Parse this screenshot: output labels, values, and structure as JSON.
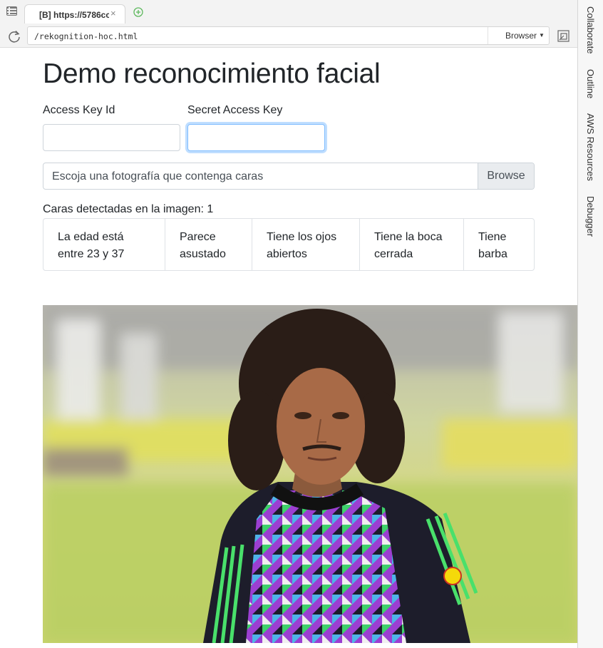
{
  "browser": {
    "tab_title": "[B] https://5786cc",
    "tab_close": "×",
    "url": "/rekognition-hoc.html",
    "browser_select": "Browser"
  },
  "side_panel": {
    "tabs": [
      "Collaborate",
      "Outline",
      "AWS Resources",
      "Debugger"
    ]
  },
  "page": {
    "title": "Demo reconocimiento facial",
    "access_key_label": "Access Key Id",
    "secret_key_label": "Secret Access Key",
    "access_key_value": "",
    "secret_key_value": "",
    "file_placeholder": "Escoja una fotografía que contenga caras",
    "browse_label": "Browse",
    "faces_label": "Caras detectadas en la imagen:",
    "faces_count": "1",
    "attributes": [
      [
        "La edad está",
        "entre 23 y 37"
      ],
      [
        "Parece",
        "asustado"
      ],
      [
        "Tiene los ojos",
        "abiertos"
      ],
      [
        "Tiene la boca",
        "cerrada"
      ],
      [
        "Tiene",
        "barba"
      ]
    ]
  },
  "colors": {
    "focus_border": "#80bdff",
    "jersey_purple": "#9b3fd1",
    "jersey_green": "#3ed16b",
    "grass": "#c8d86a"
  },
  "icons": [
    "menu-icon",
    "new-tab-icon",
    "refresh-icon",
    "popout-icon",
    "close-icon",
    "caret-down-icon"
  ]
}
